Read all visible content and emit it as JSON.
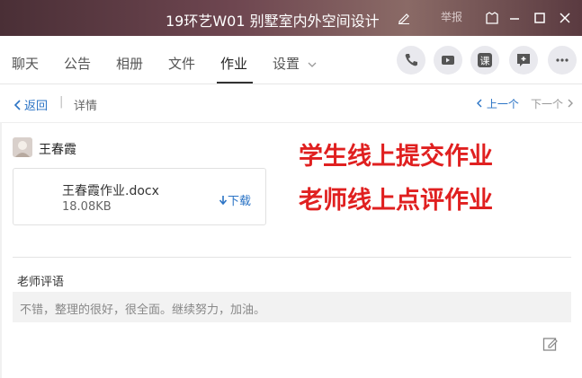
{
  "window": {
    "title": "19环艺W01 别墅室内外空间设计",
    "report_label": "举报"
  },
  "tabs": [
    {
      "label": "聊天"
    },
    {
      "label": "公告"
    },
    {
      "label": "相册"
    },
    {
      "label": "文件"
    },
    {
      "label": "作业"
    },
    {
      "label": "设置"
    }
  ],
  "active_tab": "作业",
  "actions": [
    "phone-icon",
    "video-icon",
    "class-icon",
    "add-comment-icon",
    "more-icon"
  ],
  "action_labels": {
    "class": "课"
  },
  "subnav": {
    "back_label": "返回",
    "separator": "|",
    "detail_label": "详情",
    "prev_label": "上一个",
    "next_label": "下一个"
  },
  "submission": {
    "student_name": "王春霞",
    "file_name": "王春霞作业.docx",
    "file_size": "18.08KB",
    "download_label": "下载"
  },
  "annotations": {
    "line1": "学生线上提交作业",
    "line2": "老师线上点评作业",
    "color": "#e02020"
  },
  "comment": {
    "label": "老师评语",
    "text": "不错，整理的很好，很全面。继续努力，加油。"
  },
  "colors": {
    "accent": "#2a73c5",
    "titlebar": "#5a3a40"
  }
}
